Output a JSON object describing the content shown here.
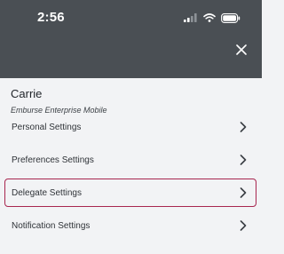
{
  "status_bar": {
    "time": "2:56"
  },
  "header": {
    "close_icon": "close-icon"
  },
  "user": {
    "name": "Carrie",
    "subtitle": "Emburse Enterprise Mobile"
  },
  "menu": {
    "items": [
      {
        "label": "Personal Settings",
        "icon": "chevron-right-icon",
        "selected": false
      },
      {
        "label": "Preferences Settings",
        "icon": "chevron-right-icon",
        "selected": false
      },
      {
        "label": "Delegate Settings",
        "icon": "chevron-right-icon",
        "selected": true
      },
      {
        "label": "Notification Settings",
        "icon": "chevron-right-icon",
        "selected": false
      }
    ]
  },
  "colors": {
    "header_bg": "#4a4f54",
    "page_bg": "#f2f3f5",
    "selection_border": "#a8264f"
  }
}
